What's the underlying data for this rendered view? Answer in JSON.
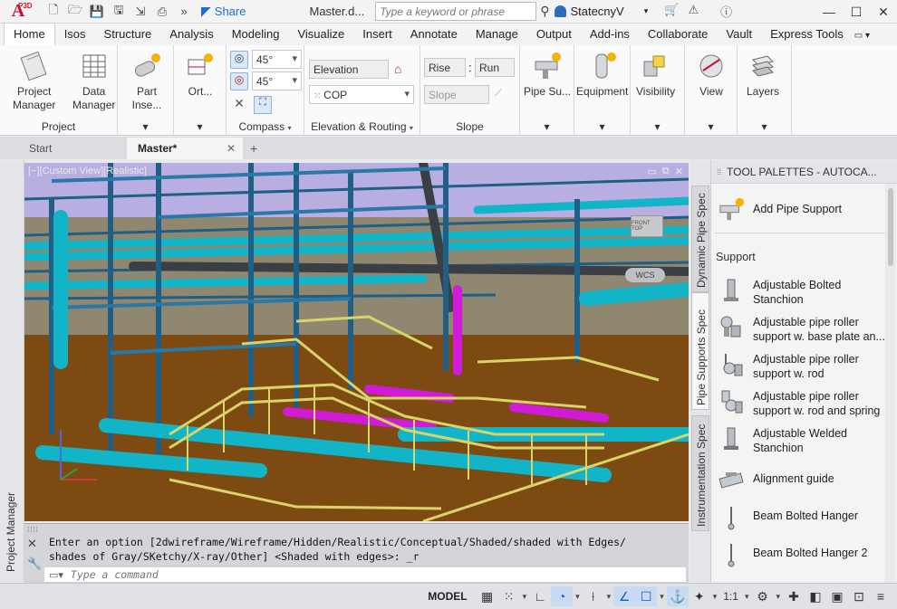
{
  "app": {
    "logo_text": "A",
    "product_badge": "P3D",
    "share_label": "Share",
    "document_title": "Master.d...",
    "search_placeholder": "Type a keyword or phrase",
    "user_name": "StatecnyV"
  },
  "ribbon_tabs": [
    "Home",
    "Isos",
    "Structure",
    "Analysis",
    "Modeling",
    "Visualize",
    "Insert",
    "Annotate",
    "Manage",
    "Output",
    "Add-ins",
    "Collaborate",
    "Vault",
    "Express Tools"
  ],
  "active_ribbon_tab": "Home",
  "ribbon": {
    "project_panel": {
      "title": "Project",
      "project_manager_label_1": "Project",
      "project_manager_label_2": "Manager",
      "data_manager_label_1": "Data",
      "data_manager_label_2": "Manager"
    },
    "part_insert_label": "Part Inse...",
    "ortho_label": "Ort...",
    "compass_panel": {
      "title": "Compass",
      "angle_1": "45°",
      "angle_2": "45°"
    },
    "elevation_panel": {
      "title": "Elevation & Routing",
      "elevation_label": "Elevation",
      "cop_label": "COP"
    },
    "slope_panel": {
      "title": "Slope",
      "rise_label": "Rise",
      "separator": ":",
      "run_label": "Run",
      "slope_placeholder": "Slope"
    },
    "pipe_supports_label": "Pipe Su...",
    "equipment_label": "Equipment",
    "visibility_label": "Visibility",
    "view_label": "View",
    "layers_label": "Layers"
  },
  "doc_tabs": {
    "start": "Start",
    "master": "Master*",
    "close": "✕",
    "new": "+"
  },
  "side_panels": {
    "project_manager": "Project Manager"
  },
  "viewport": {
    "label": "[−][Custom View][Realistic]",
    "viewcube_text": "FRONT  TOP",
    "wcs_label": "WCS",
    "ctrl_min": "▭",
    "ctrl_restore": "⧉",
    "ctrl_close": "✕"
  },
  "command": {
    "history_line_1": "Enter an option [2dwireframe/Wireframe/Hidden/Realistic/Conceptual/Shaded/shaded with Edges/",
    "history_line_2": "shades of Gray/SKetchy/X-ray/Other] <Shaded with edges>: _r",
    "input_placeholder": "Type a command"
  },
  "tool_palette": {
    "title": "TOOL PALETTES - AUTOCA...",
    "tabs": [
      "Dynamic Pipe Spec",
      "Pipe Supports Spec",
      "Instrumentation Spec"
    ],
    "active_tab": "Pipe Supports Spec",
    "add_pipe_support": "Add Pipe Support",
    "section": "Support",
    "items": [
      {
        "line1": "Adjustable Bolted",
        "line2": "Stanchion"
      },
      {
        "line1": "Adjustable pipe roller",
        "line2": "support w. base plate an..."
      },
      {
        "line1": "Adjustable pipe roller",
        "line2": "support w. rod"
      },
      {
        "line1": "Adjustable pipe roller",
        "line2": "support w. rod and spring"
      },
      {
        "line1": "Adjustable Welded",
        "line2": "Stanchion"
      },
      {
        "line1": "Alignment guide",
        "line2": ""
      },
      {
        "line1": "Beam Bolted Hanger",
        "line2": ""
      },
      {
        "line1": "Beam Bolted Hanger 2",
        "line2": ""
      }
    ]
  },
  "statusbar": {
    "model_label": "MODEL",
    "scale_label": "1:1"
  },
  "colors": {
    "accent_blue": "#1d6fc9",
    "brand_red": "#c8102e",
    "pipe_cyan": "#12b5c8",
    "steel_blue": "#1f5f86",
    "rail_yellow": "#d9d46a",
    "magenta": "#d21bd6",
    "ground_brown": "#7d4a12"
  }
}
